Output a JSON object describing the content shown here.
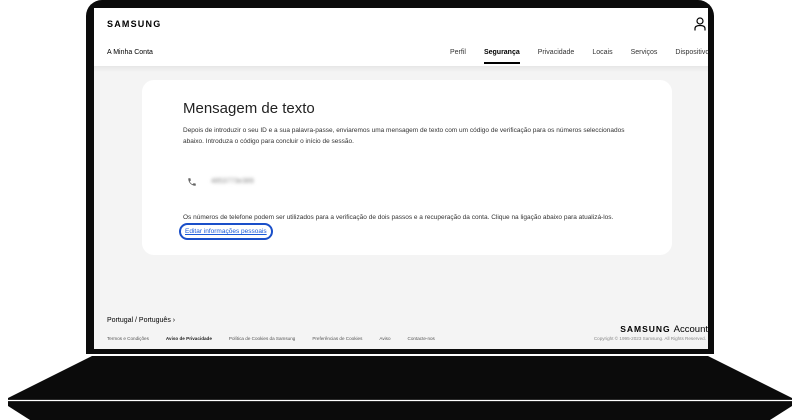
{
  "header": {
    "logo": "SAMSUNG",
    "account_title": "A Minha Conta",
    "nav": [
      {
        "label": "Perfil"
      },
      {
        "label": "Segurança",
        "active": true
      },
      {
        "label": "Privacidade"
      },
      {
        "label": "Locais"
      },
      {
        "label": "Serviços"
      },
      {
        "label": "Dispositivos"
      }
    ]
  },
  "card": {
    "title": "Mensagem de texto",
    "description": "Depois de introduzir o seu ID e a sua palavra-passe, enviaremos uma mensagem de texto com um código de verificação para os números seleccionados abaixo. Introduza o código para concluir o início de sessão.",
    "phone_number": "4853773e389",
    "note": "Os números de telefone podem ser utilizados para a verificação de dois passos e a recuperação da conta. Clique na ligação abaixo para atualizá-los.",
    "edit_link": "Editar informações pessoais"
  },
  "footer": {
    "locale": "Portugal / Português ›",
    "links": [
      {
        "label": "Termos e Condições"
      },
      {
        "label": "Aviso de Privacidade",
        "bold": true
      },
      {
        "label": "Política de Cookies da Samsung"
      },
      {
        "label": "Preferências de Cookies"
      },
      {
        "label": "Aviso"
      },
      {
        "label": "Contacte-nos"
      }
    ],
    "brand_logo": "SAMSUNG",
    "brand_account": "Account",
    "copyright": "Copyright © 1995-2023 Samsung. All Rights Reserved."
  },
  "colors": {
    "link": "#1a5ad8",
    "highlight_border": "#1a4fc9",
    "page_background": "#f4f4f4",
    "frame": "#0b0b0b"
  },
  "icons": {
    "user": "user-icon",
    "phone": "phone-icon"
  }
}
